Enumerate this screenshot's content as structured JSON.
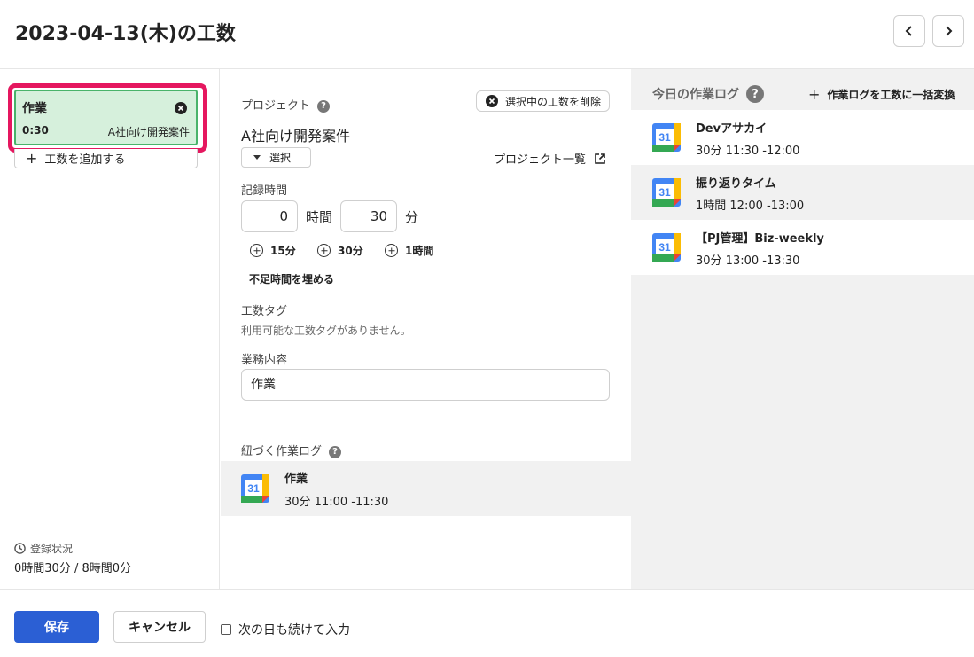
{
  "header": {
    "title": "2023-04-13(木)の工数"
  },
  "entries": [
    {
      "name": "作業",
      "time": "0:30",
      "project": "A社向け開発案件"
    }
  ],
  "left": {
    "add_entry_label": "工数を追加する",
    "registration_label": "登録状況",
    "registration_value": "0時間30分 / 8時間0分"
  },
  "form": {
    "project_label": "プロジェクト",
    "delete_selected_label": "選択中の工数を削除",
    "project_name": "A社向け開発案件",
    "select_label": "選択",
    "project_list_label": "プロジェクト一覧",
    "record_time_label": "記録時間",
    "hours_value": "0",
    "hours_unit": "時間",
    "minutes_value": "30",
    "minutes_unit": "分",
    "quick_add": [
      "15分",
      "30分",
      "1時間"
    ],
    "fill_missing_label": "不足時間を埋める",
    "tag_label": "工数タグ",
    "no_tags_text": "利用可能な工数タグがありません。",
    "description_label": "業務内容",
    "description_value": "作業",
    "linked_logs_label": "紐づく作業ログ",
    "linked_logs": [
      {
        "name": "作業",
        "time": "30分  11:00 -11:30"
      }
    ]
  },
  "today": {
    "title": "今日の作業ログ",
    "bulk_convert_label": "作業ログを工数に一括変換",
    "logs": [
      {
        "name": "Devアサカイ",
        "time": "30分  11:30 -12:00"
      },
      {
        "name": "振り返りタイム",
        "time": "1時間  12:00 -13:00"
      },
      {
        "name": "【PJ管理】Biz-weekly",
        "time": "30分  13:00 -13:30"
      }
    ]
  },
  "calendar_icon_text": "31",
  "footer": {
    "save_label": "保存",
    "cancel_label": "キャンセル",
    "continue_label": "次の日も続けて入力"
  },
  "colors": {
    "highlight": "#e5175f",
    "entry_bg": "#d6f0dc",
    "entry_border": "#49b36a",
    "primary": "#2b5fd4"
  }
}
